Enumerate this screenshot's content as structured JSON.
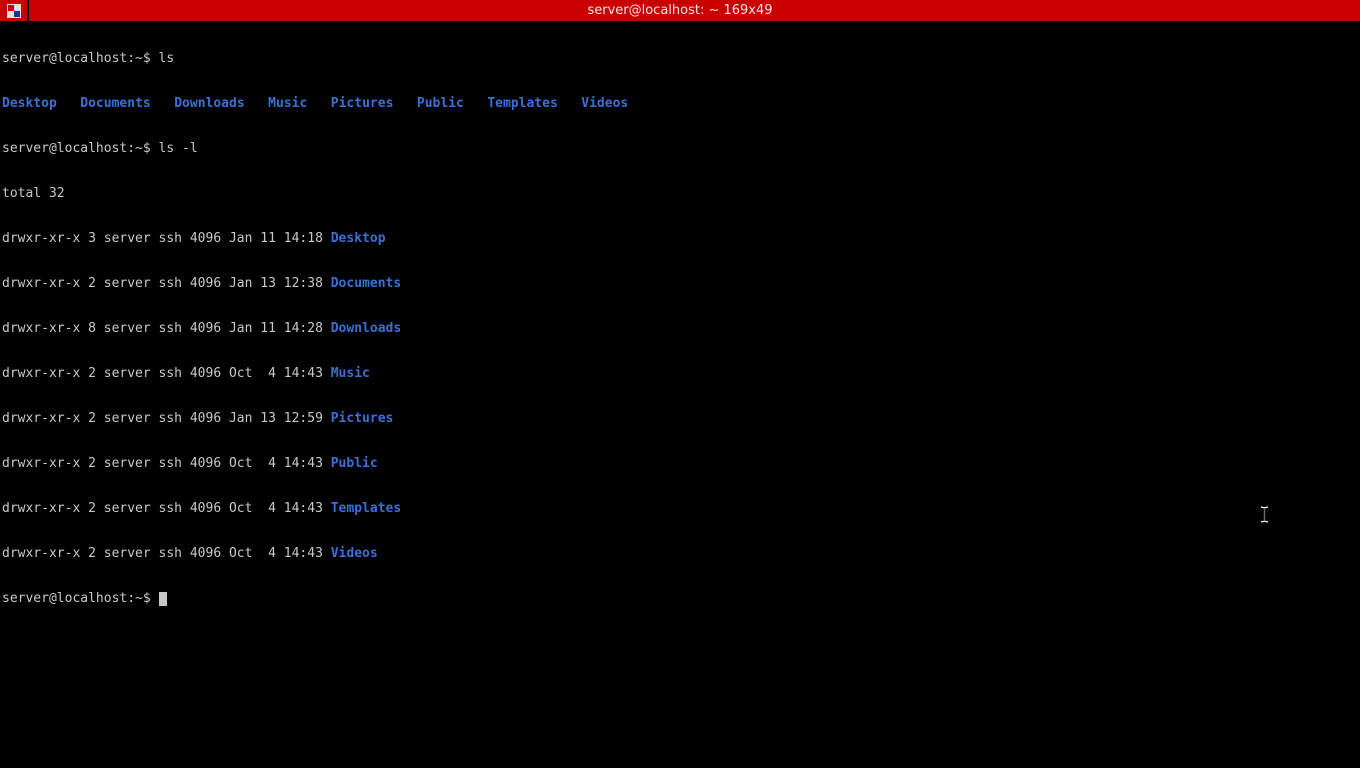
{
  "window": {
    "title": "server@localhost: ~ 169x49"
  },
  "prompt": "server@localhost:~$ ",
  "cmd1": "ls",
  "ls_short": [
    "Desktop",
    "Documents",
    "Downloads",
    "Music",
    "Pictures",
    "Public",
    "Templates",
    "Videos"
  ],
  "cmd2": "ls -l",
  "total_line": "total 32",
  "ls_long": [
    {
      "meta": "drwxr-xr-x 3 server ssh 4096 Jan 11 14:18 ",
      "name": "Desktop"
    },
    {
      "meta": "drwxr-xr-x 2 server ssh 4096 Jan 13 12:38 ",
      "name": "Documents"
    },
    {
      "meta": "drwxr-xr-x 8 server ssh 4096 Jan 11 14:28 ",
      "name": "Downloads"
    },
    {
      "meta": "drwxr-xr-x 2 server ssh 4096 Oct  4 14:43 ",
      "name": "Music"
    },
    {
      "meta": "drwxr-xr-x 2 server ssh 4096 Jan 13 12:59 ",
      "name": "Pictures"
    },
    {
      "meta": "drwxr-xr-x 2 server ssh 4096 Oct  4 14:43 ",
      "name": "Public"
    },
    {
      "meta": "drwxr-xr-x 2 server ssh 4096 Oct  4 14:43 ",
      "name": "Templates"
    },
    {
      "meta": "drwxr-xr-x 2 server ssh 4096 Oct  4 14:43 ",
      "name": "Videos"
    }
  ]
}
